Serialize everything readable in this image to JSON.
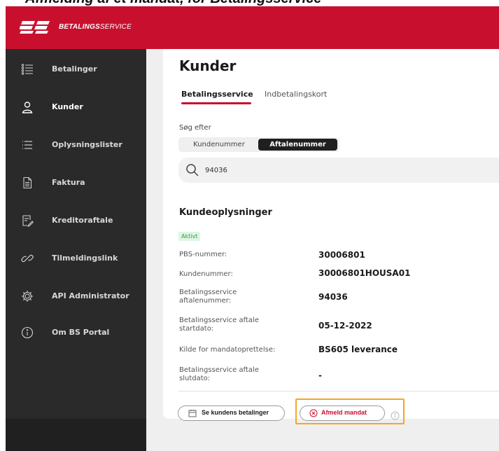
{
  "caption": {
    "text": "Afmelding af et mandat, for Betalingsservice"
  },
  "header": {
    "brand_bold": "BETALINGS",
    "brand_light": "SERVICE"
  },
  "sidebar": {
    "items": [
      {
        "label": "Betalinger",
        "icon": "list-icon"
      },
      {
        "label": "Kunder",
        "icon": "user-icon"
      },
      {
        "label": "Oplysningslister",
        "icon": "menu-icon"
      },
      {
        "label": "Faktura",
        "icon": "document-icon"
      },
      {
        "label": "Kreditoraftale",
        "icon": "edit-document-icon"
      },
      {
        "label": "Tilmeldingslink",
        "icon": "link-icon"
      },
      {
        "label": "API Administrator",
        "icon": "gear-icon"
      },
      {
        "label": "Om BS Portal",
        "icon": "info-icon"
      }
    ]
  },
  "main": {
    "title": "Kunder",
    "tabs": [
      {
        "label": "Betalingsservice"
      },
      {
        "label": "Indbetalingskort"
      }
    ],
    "search": {
      "label": "Søg efter",
      "options": [
        "Kundenummer",
        "Aftalenummer"
      ],
      "value": "94036"
    },
    "customer_info": {
      "title": "Kundeoplysninger",
      "status": "Aktivt",
      "fields": [
        {
          "label": "PBS-nummer:",
          "value": "30006801"
        },
        {
          "label": "Kundenummer:",
          "value": "30006801HOUSA01"
        },
        {
          "label": "Betalingsservice aftalenummer:",
          "value": "94036"
        },
        {
          "label": "Betalingsservice aftale startdato:",
          "value": "05-12-2022"
        },
        {
          "label": "Kilde for mandatoprettelse:",
          "value": "BS605 leverance"
        },
        {
          "label": "Betalingsservice aftale slutdato:",
          "value": "-"
        }
      ]
    },
    "actions": {
      "payments_label": "Se kundens betalinger",
      "unsubscribe_label": "Afmeld mandat"
    }
  },
  "colors": {
    "brand_red": "#c8102e",
    "sidebar_bg": "#2a2a2a",
    "status_green": "#2f9a48",
    "highlight_orange": "#f5a623"
  }
}
